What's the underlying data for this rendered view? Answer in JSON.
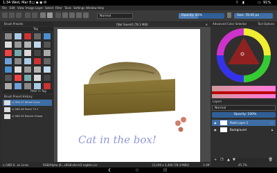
{
  "statusbar": {
    "time": "1:34",
    "date": "Wed, Mar 8",
    "battery": "91%"
  },
  "menubar": {
    "items": [
      "File",
      "Edit",
      "View",
      "Image",
      "Layer",
      "Select",
      "Filter",
      "Tools",
      "Settings",
      "Window",
      "Help"
    ]
  },
  "toolbar": {
    "blend_mode": "Normal",
    "opacity_label": "Opacity: 43%",
    "opacity_value": 0.43,
    "size_label": "Size: 78.00 px"
  },
  "left_dock": {
    "brush_presets_title": "Brush Presets",
    "tag_label": "Tag",
    "filter_label": "Filter in Tag",
    "history_title": "Brush Preset History",
    "history_items": [
      "c) SKD 07 Wheel Lines",
      "c) SKD 08 Pencil T3-7",
      "c) SKD 05 Electric Eraser"
    ]
  },
  "canvas": {
    "tab_title": "[Not Saved]  (78.3 MiB)",
    "handwriting": "Cat in the box!"
  },
  "right_dock": {
    "color_selector_title": "Advanced Color Selector",
    "tab_other": "Tool Options",
    "layers_title": "Layers",
    "layers_blend": "Normal",
    "layers_opacity": "Opacity: 100%",
    "layers": [
      {
        "name": "Paint Layer 1",
        "selected": true
      },
      {
        "name": "Background",
        "selected": false
      }
    ]
  },
  "app_status": {
    "brush": "c) SKD 0...eL Lines",
    "color_profile": "RGB/Alpha (8...sRGB-elle-V2-srgbtrc.icc",
    "dimensions": "[3,100 x 3,300 (78.3 MiB)]",
    "rotation": "-1.99°",
    "zoom": "45.7%"
  }
}
